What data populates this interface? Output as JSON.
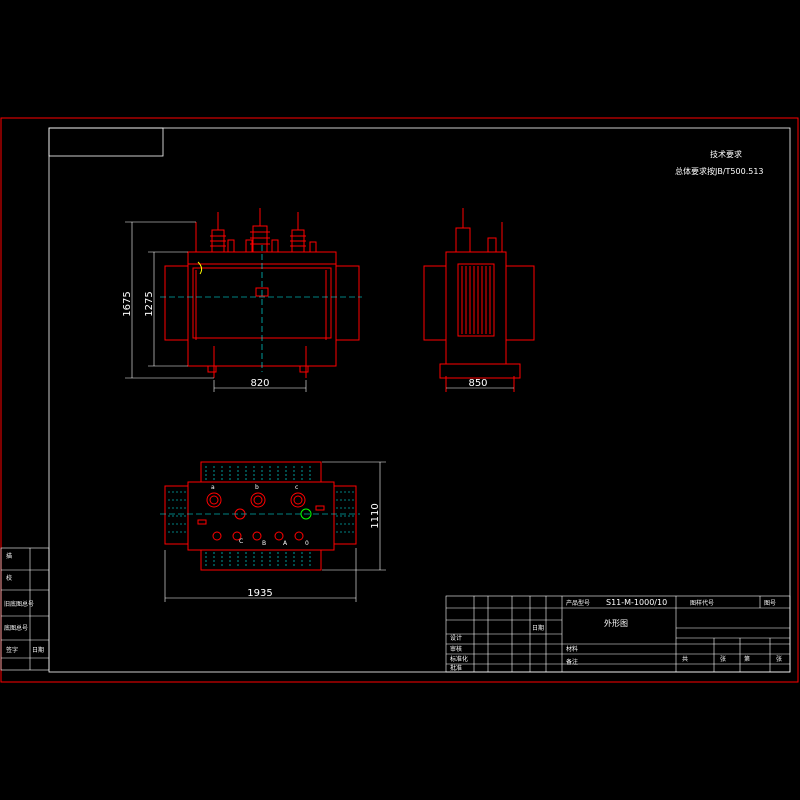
{
  "drawing": {
    "tech_req_label": "技术要求",
    "standard_text": "总体要求按JB/T500.513",
    "part_no": "S11-M-1000/10",
    "sheet_title": "外形图"
  },
  "dimensions": {
    "front_total_height": "1675",
    "front_body_height": "1275",
    "front_width": "820",
    "side_width": "850",
    "plan_depth": "1110",
    "plan_length": "1935"
  },
  "terminal_labels": [
    "a",
    "b",
    "c",
    "C",
    "B",
    "A",
    "0"
  ],
  "title_block": {
    "left_rows": [
      "描",
      "校",
      "旧底图总号",
      "底图总号",
      "签字",
      "日期"
    ],
    "header_cells": [
      "产品型号",
      "S11-M-1000/10",
      "图样代号",
      "图号"
    ],
    "sign_rows": [
      "设计",
      "审核",
      "标准化",
      "批准",
      "日期"
    ],
    "misc": [
      "材料",
      "备注",
      "共",
      "张",
      "第",
      "张"
    ]
  },
  "colors": {
    "frame": "#ff0000",
    "drawing": "#ff0000",
    "centerline": "#00ffff",
    "text": "#ffffff",
    "accent": "#00ff00"
  }
}
